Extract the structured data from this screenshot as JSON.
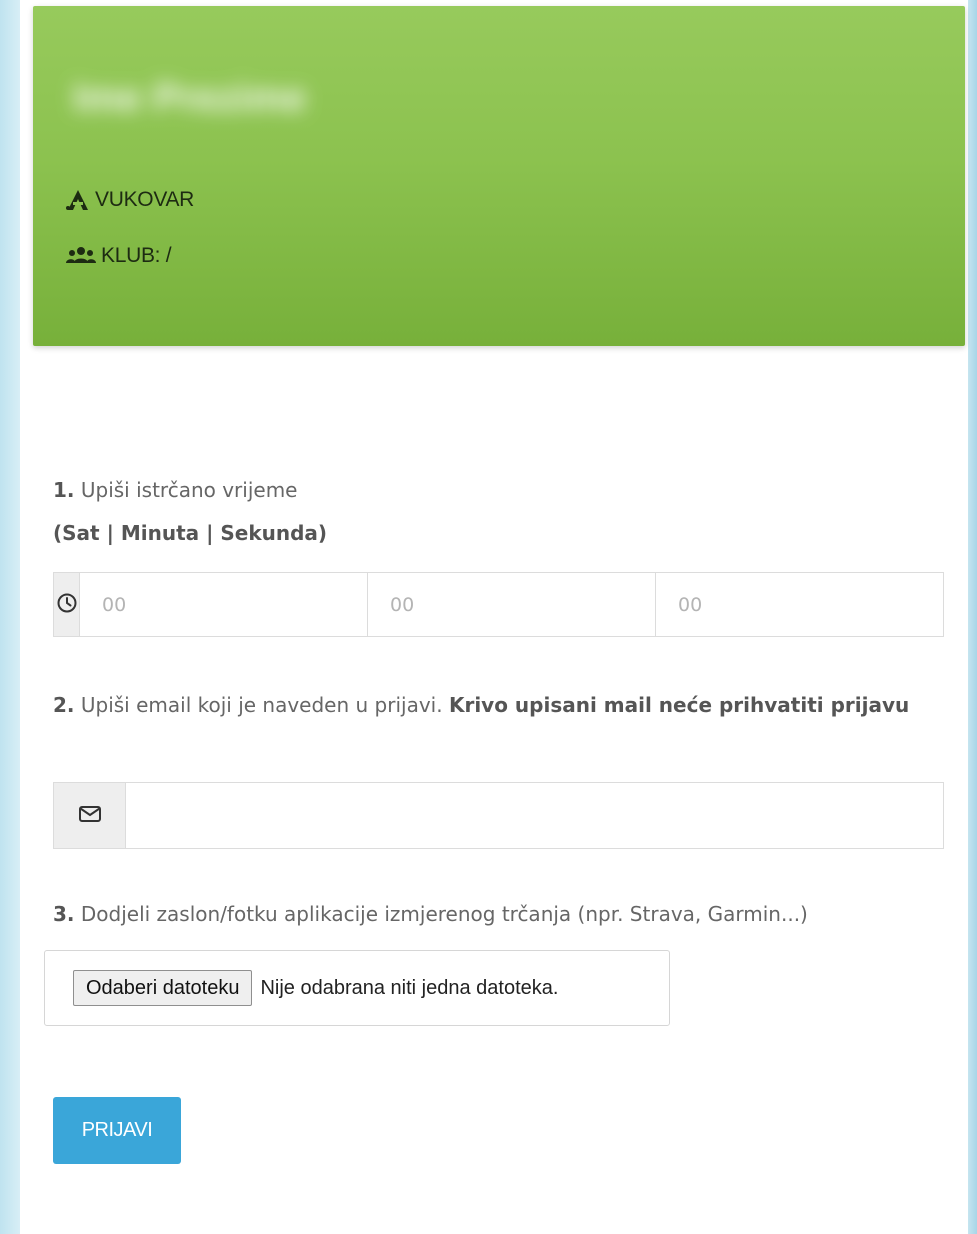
{
  "header": {
    "name_blurred": "Ime Prezime",
    "city": "VUKOVAR",
    "club": "KLUB: /",
    "city_icon": "runner-icon",
    "club_icon": "users-icon",
    "accent_color": "#8cc24f"
  },
  "step1": {
    "number": "1.",
    "text": "Upiši istrčano vrijeme",
    "subtitle": "(Sat | Minuta | Sekunda)",
    "icon": "clock-icon",
    "fields": [
      {
        "placeholder": "00",
        "value": ""
      },
      {
        "placeholder": "00",
        "value": ""
      },
      {
        "placeholder": "00",
        "value": ""
      }
    ]
  },
  "step2": {
    "number": "2.",
    "text": "Upiši email koji je naveden u prijavi.",
    "bold_text": "Krivo upisani mail neće prihvatiti prijavu",
    "icon": "envelope-icon",
    "email_value": ""
  },
  "step3": {
    "number": "3.",
    "text": "Dodjeli zaslon/fotku aplikacije izmjerenog trčanja (npr. Strava, Garmin...)",
    "file_button": "Odaberi datoteku",
    "file_status": "Nije odabrana niti jedna datoteka."
  },
  "submit": {
    "label": "PRIJAVI",
    "color": "#3aa6d9"
  }
}
